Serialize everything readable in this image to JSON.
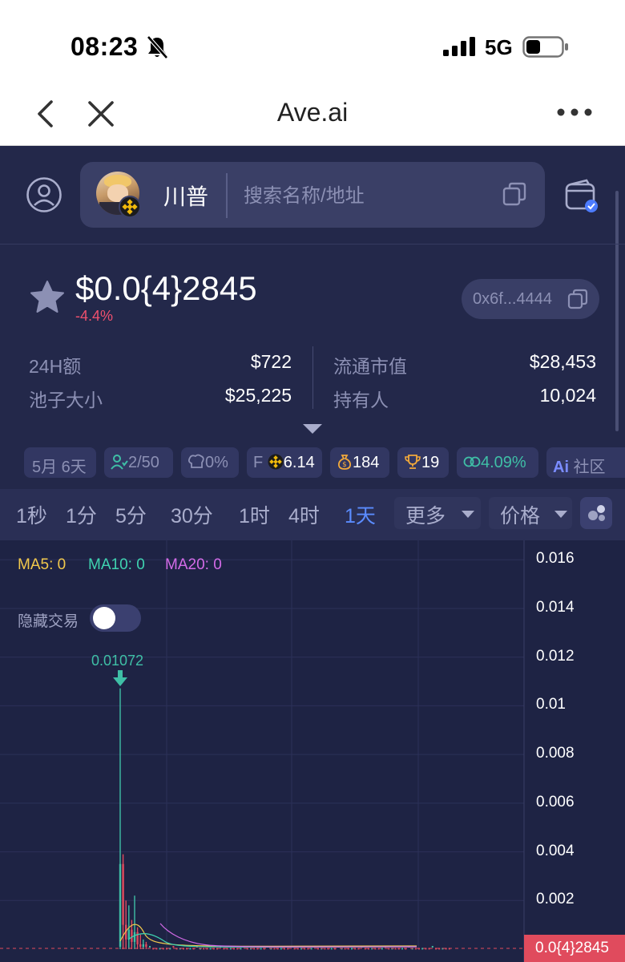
{
  "status_bar": {
    "time": "08:23",
    "network": "5G"
  },
  "browser": {
    "title": "Ave.ai"
  },
  "search": {
    "token_name": "川普",
    "placeholder": "搜索名称/地址"
  },
  "token": {
    "price": "$0.0{4}2845",
    "change": "-4.4%",
    "address": "0x6f...4444",
    "stats": [
      {
        "label": "24H额",
        "value": "$722"
      },
      {
        "label": "池子大小",
        "value": "$25,225"
      },
      {
        "label": "流通市值",
        "value": "$28,453"
      },
      {
        "label": "持有人",
        "value": "10,024"
      }
    ]
  },
  "tags": [
    "5月 6天",
    "2/50",
    "0%",
    "F",
    "6.14",
    "184",
    "19",
    "4.09%",
    "社区"
  ],
  "tags_ai": "Ai",
  "intervals": [
    "1秒",
    "1分",
    "5分",
    "30分",
    "1时",
    "4时",
    "1天"
  ],
  "active_interval": "1天",
  "more_label": "更多",
  "price_mode_label": "价格",
  "chart": {
    "ma": [
      {
        "label": "MA5: 0",
        "color": "#f2c94c"
      },
      {
        "label": "MA10: 0",
        "color": "#3fd3b0"
      },
      {
        "label": "MA20: 0",
        "color": "#d46be8"
      }
    ],
    "hide_trades_label": "隐藏交易",
    "hide_trades_on": false,
    "high_label": "0.01072",
    "current_price_label": "0.0{4}2845"
  },
  "chart_data": {
    "type": "candlestick",
    "y_ticks": [
      "0.016",
      "0.014",
      "0.012",
      "0.01",
      "0.008",
      "0.006",
      "0.004",
      "0.002"
    ],
    "ylim": [
      0,
      0.0168
    ],
    "candles": [
      {
        "o": 0.0001,
        "h": 0.01072,
        "l": 0.0,
        "c": 0.0035,
        "dir": "up"
      },
      {
        "o": 0.0035,
        "h": 0.0039,
        "l": 0.0,
        "c": 0.001,
        "dir": "down"
      },
      {
        "o": 0.001,
        "h": 0.002,
        "l": 0.0,
        "c": 0.0004,
        "dir": "down"
      },
      {
        "o": 0.0004,
        "h": 0.0018,
        "l": 0.0,
        "c": 0.0008,
        "dir": "up"
      },
      {
        "o": 0.0008,
        "h": 0.0012,
        "l": 0.0,
        "c": 0.0003,
        "dir": "down"
      },
      {
        "o": 0.0003,
        "h": 0.0022,
        "l": 0.0,
        "c": 0.0007,
        "dir": "up"
      },
      {
        "o": 0.0007,
        "h": 0.0009,
        "l": 0.0,
        "c": 0.0002,
        "dir": "down"
      },
      {
        "o": 0.0002,
        "h": 0.0006,
        "l": 0.0,
        "c": 0.0001,
        "dir": "down"
      },
      {
        "o": 0.0001,
        "h": 0.0004,
        "l": 0.0,
        "c": 0.0002,
        "dir": "up"
      },
      {
        "o": 0.0002,
        "h": 0.0003,
        "l": 0.0,
        "c": 0.0001,
        "dir": "down"
      }
    ],
    "current_price": 2.845e-05,
    "grid": true,
    "colors": {
      "up": "#3fbfa6",
      "down": "#e04b5d"
    }
  }
}
